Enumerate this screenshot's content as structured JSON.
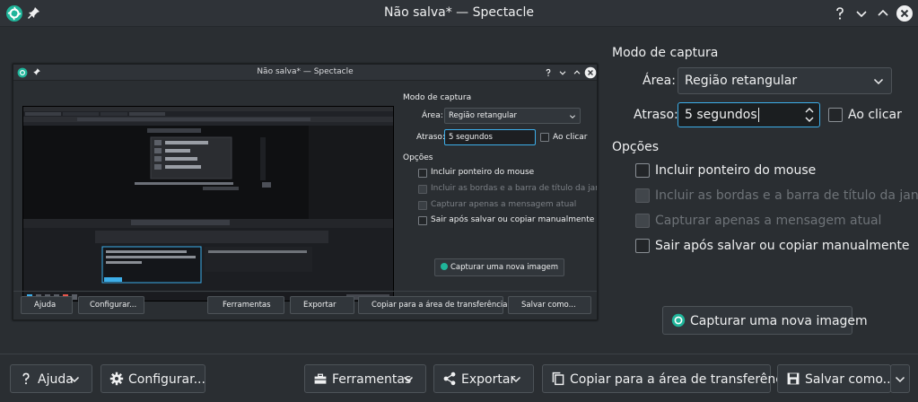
{
  "window": {
    "title": "Não salva* — Spectacle",
    "help_icon": "question-icon",
    "minimize_icon": "chevron-down-icon",
    "maximize_icon": "chevron-up-icon",
    "close_icon": "close-icon",
    "pin_icon": "pin-icon",
    "app_icon": "spectacle-icon"
  },
  "capture_mode": {
    "heading": "Modo de captura",
    "area_label": "Área:",
    "area_value": "Região retangular",
    "delay_label": "Atraso:",
    "delay_value": "5 segundos",
    "on_click_label": "Ao clicar",
    "on_click_checked": false
  },
  "options": {
    "heading": "Opções",
    "items": [
      {
        "label": "Incluir ponteiro do mouse",
        "checked": false,
        "enabled": true
      },
      {
        "label": "Incluir as bordas e a barra de título da janela",
        "checked": false,
        "enabled": false
      },
      {
        "label": "Capturar apenas a mensagem atual",
        "checked": false,
        "enabled": false
      },
      {
        "label": "Sair após salvar ou copiar manualmente",
        "checked": false,
        "enabled": true
      }
    ]
  },
  "new_capture_label": "Capturar uma nova imagem",
  "footer": {
    "help_label": "Ajuda",
    "configure_label": "Configurar...",
    "tools_label": "Ferramentas",
    "export_label": "Exportar",
    "copy_label": "Copiar para a área de transferência",
    "save_label": "Salvar como..."
  },
  "colors": {
    "window_bg": "#2a2e32",
    "accent": "#3daee9",
    "text": "#eff0f1"
  }
}
